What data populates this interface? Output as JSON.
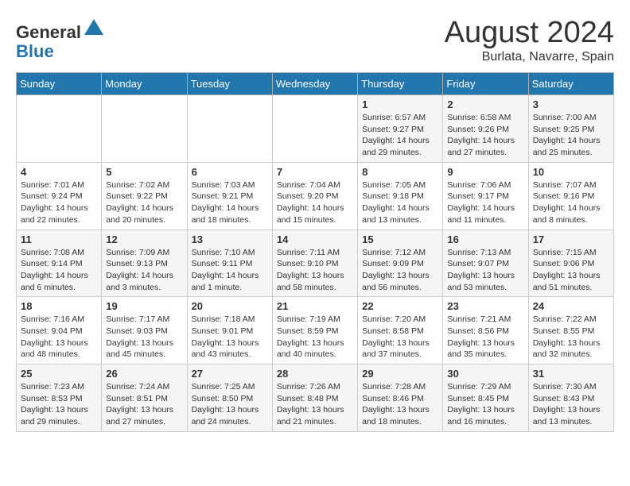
{
  "header": {
    "logo_general": "General",
    "logo_blue": "Blue",
    "month": "August 2024",
    "location": "Burlata, Navarre, Spain"
  },
  "days_of_week": [
    "Sunday",
    "Monday",
    "Tuesday",
    "Wednesday",
    "Thursday",
    "Friday",
    "Saturday"
  ],
  "weeks": [
    [
      {
        "num": "",
        "info": ""
      },
      {
        "num": "",
        "info": ""
      },
      {
        "num": "",
        "info": ""
      },
      {
        "num": "",
        "info": ""
      },
      {
        "num": "1",
        "info": "Sunrise: 6:57 AM\nSunset: 9:27 PM\nDaylight: 14 hours\nand 29 minutes."
      },
      {
        "num": "2",
        "info": "Sunrise: 6:58 AM\nSunset: 9:26 PM\nDaylight: 14 hours\nand 27 minutes."
      },
      {
        "num": "3",
        "info": "Sunrise: 7:00 AM\nSunset: 9:25 PM\nDaylight: 14 hours\nand 25 minutes."
      }
    ],
    [
      {
        "num": "4",
        "info": "Sunrise: 7:01 AM\nSunset: 9:24 PM\nDaylight: 14 hours\nand 22 minutes."
      },
      {
        "num": "5",
        "info": "Sunrise: 7:02 AM\nSunset: 9:22 PM\nDaylight: 14 hours\nand 20 minutes."
      },
      {
        "num": "6",
        "info": "Sunrise: 7:03 AM\nSunset: 9:21 PM\nDaylight: 14 hours\nand 18 minutes."
      },
      {
        "num": "7",
        "info": "Sunrise: 7:04 AM\nSunset: 9:20 PM\nDaylight: 14 hours\nand 15 minutes."
      },
      {
        "num": "8",
        "info": "Sunrise: 7:05 AM\nSunset: 9:18 PM\nDaylight: 14 hours\nand 13 minutes."
      },
      {
        "num": "9",
        "info": "Sunrise: 7:06 AM\nSunset: 9:17 PM\nDaylight: 14 hours\nand 11 minutes."
      },
      {
        "num": "10",
        "info": "Sunrise: 7:07 AM\nSunset: 9:16 PM\nDaylight: 14 hours\nand 8 minutes."
      }
    ],
    [
      {
        "num": "11",
        "info": "Sunrise: 7:08 AM\nSunset: 9:14 PM\nDaylight: 14 hours\nand 6 minutes."
      },
      {
        "num": "12",
        "info": "Sunrise: 7:09 AM\nSunset: 9:13 PM\nDaylight: 14 hours\nand 3 minutes."
      },
      {
        "num": "13",
        "info": "Sunrise: 7:10 AM\nSunset: 9:11 PM\nDaylight: 14 hours\nand 1 minute."
      },
      {
        "num": "14",
        "info": "Sunrise: 7:11 AM\nSunset: 9:10 PM\nDaylight: 13 hours\nand 58 minutes."
      },
      {
        "num": "15",
        "info": "Sunrise: 7:12 AM\nSunset: 9:09 PM\nDaylight: 13 hours\nand 56 minutes."
      },
      {
        "num": "16",
        "info": "Sunrise: 7:13 AM\nSunset: 9:07 PM\nDaylight: 13 hours\nand 53 minutes."
      },
      {
        "num": "17",
        "info": "Sunrise: 7:15 AM\nSunset: 9:06 PM\nDaylight: 13 hours\nand 51 minutes."
      }
    ],
    [
      {
        "num": "18",
        "info": "Sunrise: 7:16 AM\nSunset: 9:04 PM\nDaylight: 13 hours\nand 48 minutes."
      },
      {
        "num": "19",
        "info": "Sunrise: 7:17 AM\nSunset: 9:03 PM\nDaylight: 13 hours\nand 45 minutes."
      },
      {
        "num": "20",
        "info": "Sunrise: 7:18 AM\nSunset: 9:01 PM\nDaylight: 13 hours\nand 43 minutes."
      },
      {
        "num": "21",
        "info": "Sunrise: 7:19 AM\nSunset: 8:59 PM\nDaylight: 13 hours\nand 40 minutes."
      },
      {
        "num": "22",
        "info": "Sunrise: 7:20 AM\nSunset: 8:58 PM\nDaylight: 13 hours\nand 37 minutes."
      },
      {
        "num": "23",
        "info": "Sunrise: 7:21 AM\nSunset: 8:56 PM\nDaylight: 13 hours\nand 35 minutes."
      },
      {
        "num": "24",
        "info": "Sunrise: 7:22 AM\nSunset: 8:55 PM\nDaylight: 13 hours\nand 32 minutes."
      }
    ],
    [
      {
        "num": "25",
        "info": "Sunrise: 7:23 AM\nSunset: 8:53 PM\nDaylight: 13 hours\nand 29 minutes."
      },
      {
        "num": "26",
        "info": "Sunrise: 7:24 AM\nSunset: 8:51 PM\nDaylight: 13 hours\nand 27 minutes."
      },
      {
        "num": "27",
        "info": "Sunrise: 7:25 AM\nSunset: 8:50 PM\nDaylight: 13 hours\nand 24 minutes."
      },
      {
        "num": "28",
        "info": "Sunrise: 7:26 AM\nSunset: 8:48 PM\nDaylight: 13 hours\nand 21 minutes."
      },
      {
        "num": "29",
        "info": "Sunrise: 7:28 AM\nSunset: 8:46 PM\nDaylight: 13 hours\nand 18 minutes."
      },
      {
        "num": "30",
        "info": "Sunrise: 7:29 AM\nSunset: 8:45 PM\nDaylight: 13 hours\nand 16 minutes."
      },
      {
        "num": "31",
        "info": "Sunrise: 7:30 AM\nSunset: 8:43 PM\nDaylight: 13 hours\nand 13 minutes."
      }
    ]
  ]
}
